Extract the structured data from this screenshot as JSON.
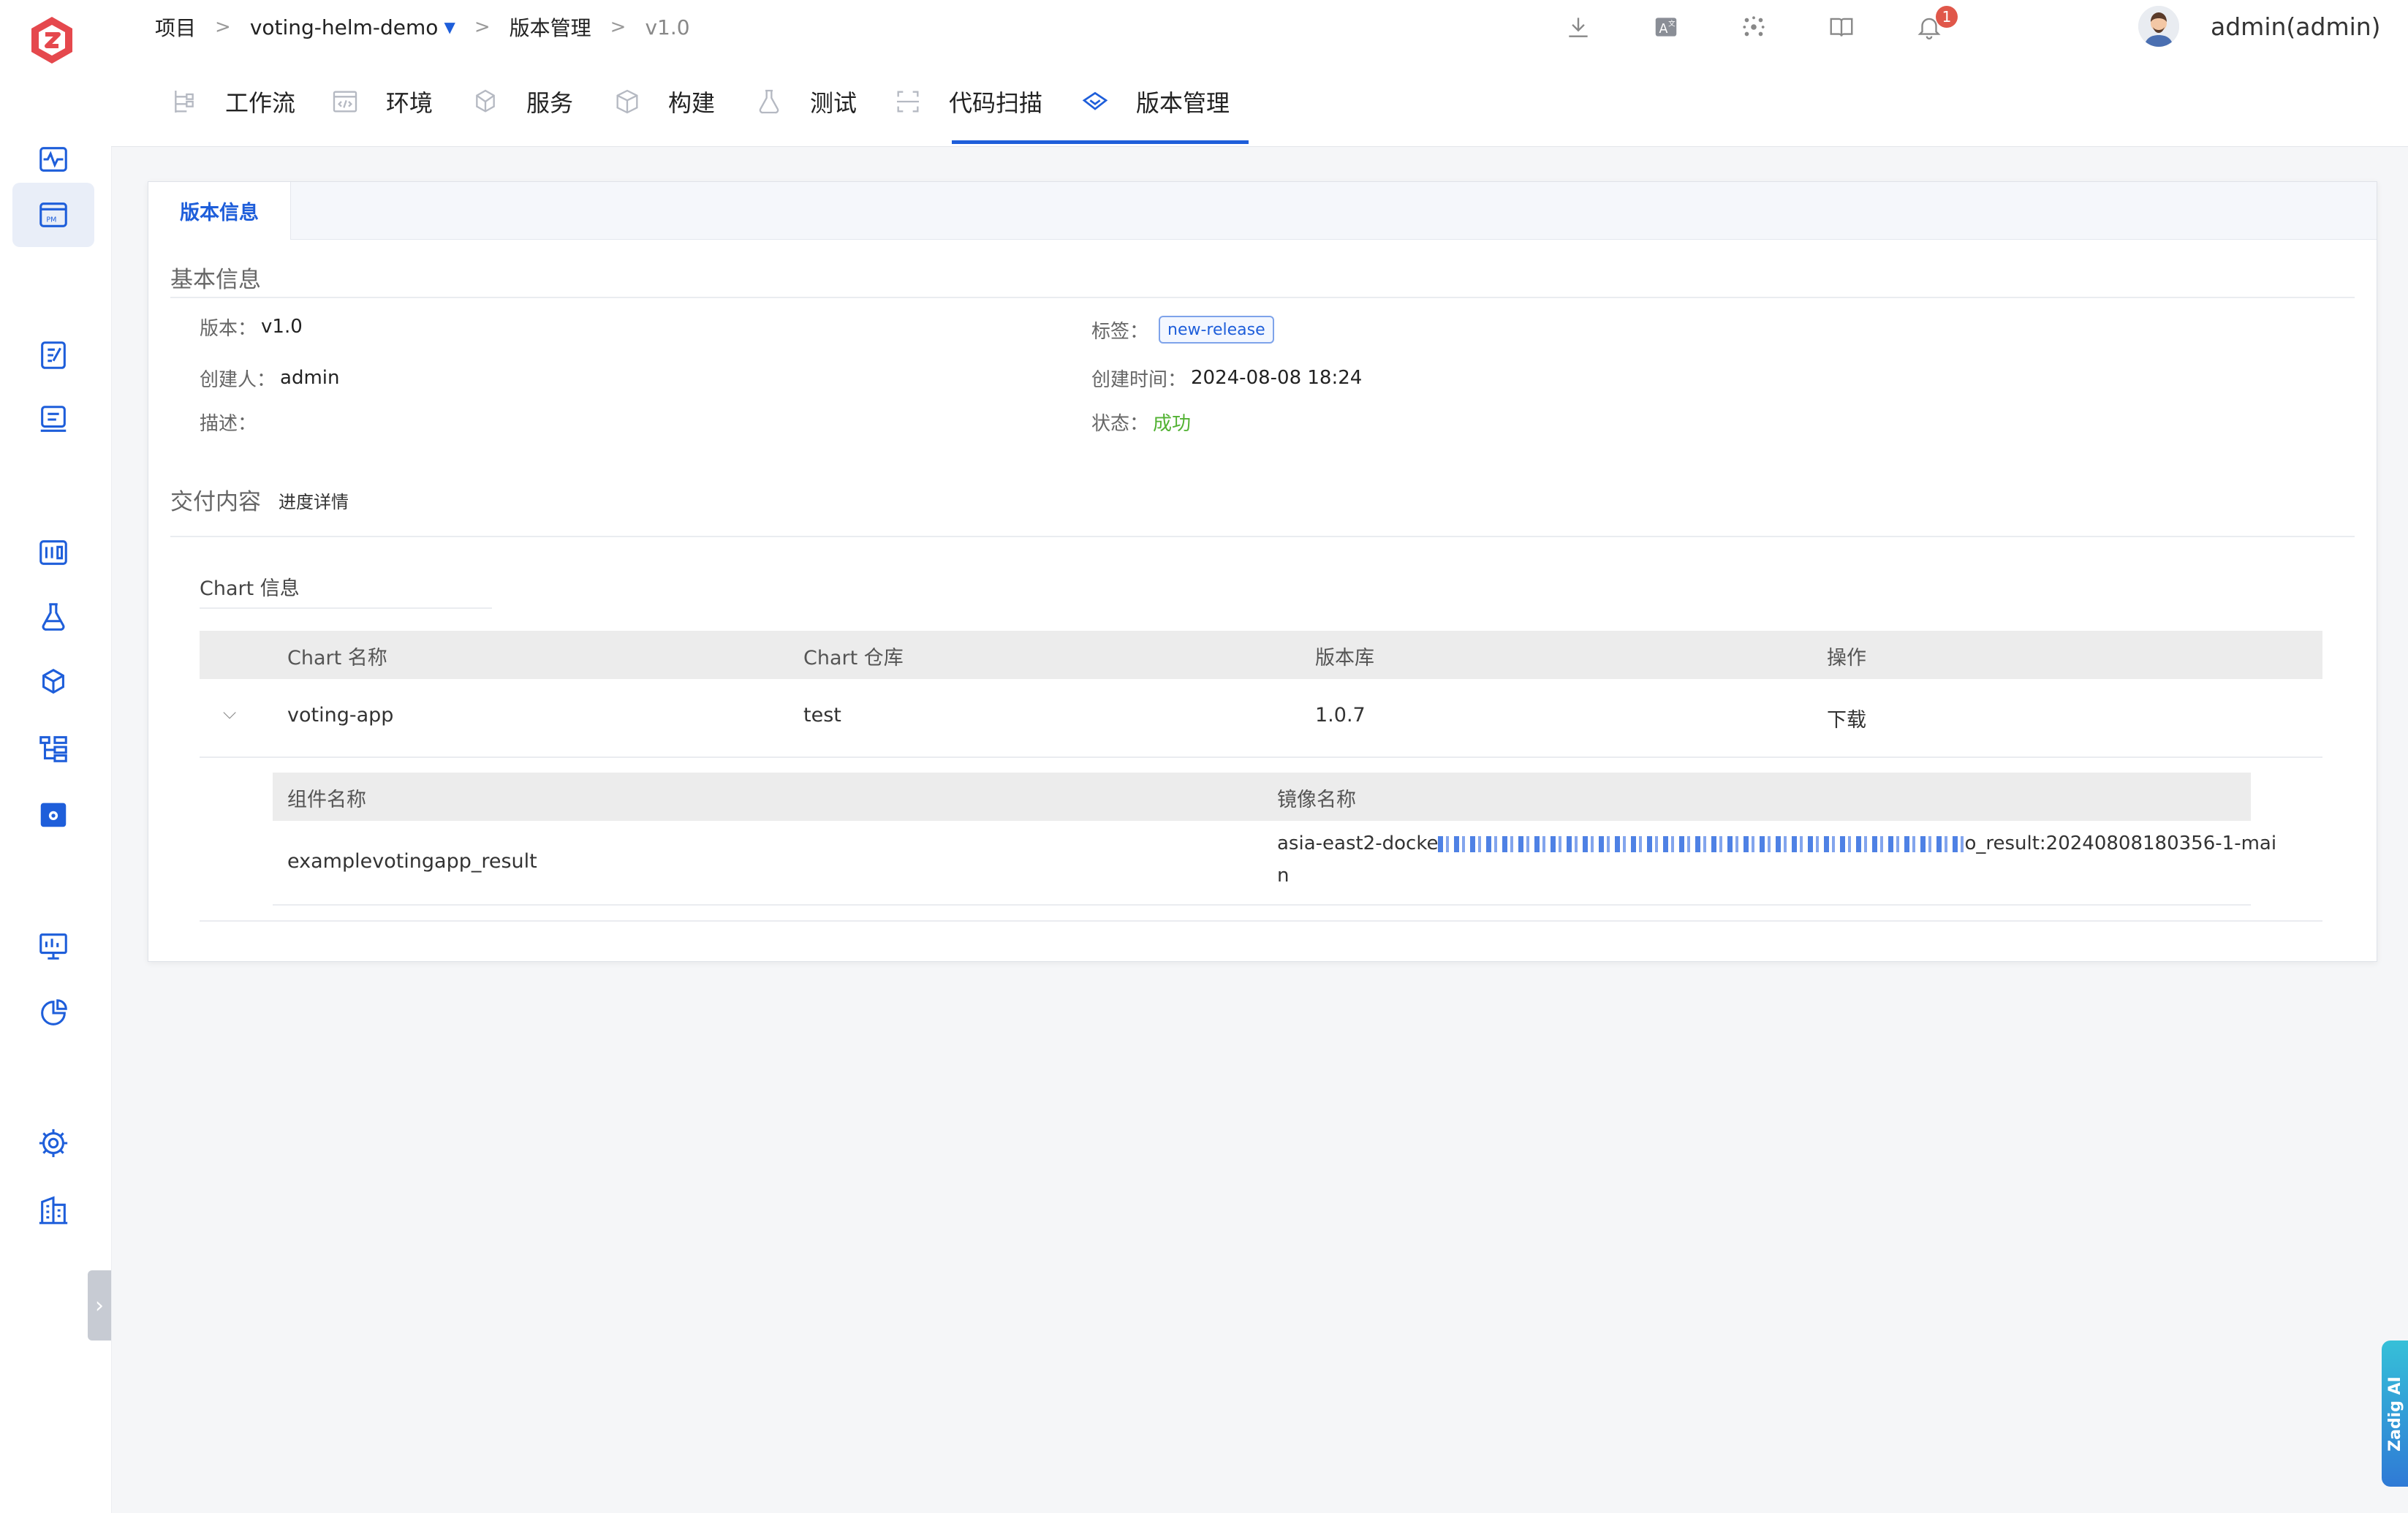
{
  "breadcrumb": {
    "project": "项目",
    "project_name": "voting-helm-demo",
    "section": "版本管理",
    "current": "v1.0"
  },
  "header": {
    "notification_count": "1",
    "username": "admin(admin)"
  },
  "tabs": [
    {
      "label": "工作流"
    },
    {
      "label": "环境"
    },
    {
      "label": "服务"
    },
    {
      "label": "构建"
    },
    {
      "label": "测试"
    },
    {
      "label": "代码扫描"
    },
    {
      "label": "版本管理"
    }
  ],
  "card": {
    "tab": "版本信息",
    "basic": {
      "title": "基本信息",
      "version_label": "版本：",
      "version": "v1.0",
      "tag_label": "标签：",
      "tag": "new-release",
      "creator_label": "创建人：",
      "creator": "admin",
      "created_label": "创建时间：",
      "created": "2024-08-08 18:24",
      "desc_label": "描述：",
      "status_label": "状态：",
      "status": "成功"
    },
    "delivery": {
      "title": "交付内容",
      "progress_link": "进度详情",
      "chart_section": "Chart 信息",
      "columns": [
        "Chart 名称",
        "Chart 仓库",
        "版本库",
        "操作"
      ],
      "rows": [
        {
          "name": "voting-app",
          "repo": "test",
          "version": "1.0.7",
          "action": "下载"
        }
      ],
      "sub_columns": [
        "组件名称",
        "镜像名称"
      ],
      "sub_rows": [
        {
          "component": "examplevotingapp_result",
          "image_prefix": "asia-east2-docke",
          "image_suffix": "o_result:20240808180356-1-mai",
          "image_wrap": "n"
        }
      ]
    }
  },
  "ai_tab": "Zadig AI",
  "colors": {
    "primary": "#1e5eda",
    "success": "#52b233",
    "badge": "#e0574a"
  }
}
